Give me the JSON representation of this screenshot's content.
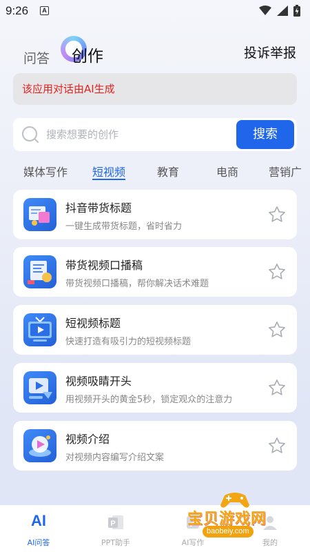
{
  "status": {
    "time": "9:26",
    "notif_letter": "A"
  },
  "header": {
    "tab_qa": "问答",
    "tab_create": "创作",
    "report": "投诉举报"
  },
  "notice": {
    "text": "该应用对话由AI生成"
  },
  "search": {
    "placeholder": "搜索想要的创作",
    "button": "搜索"
  },
  "categories": [
    "媒体写作",
    "短视频",
    "教育",
    "电商",
    "营销广"
  ],
  "active_category": "短视频",
  "cards": [
    {
      "title": "抖音带货标题",
      "desc": "一键生成带货标题，省时省力",
      "icon": "shopping-title-icon"
    },
    {
      "title": "带货视频口播稿",
      "desc": "带货视频口播稿，帮你解决话术难题",
      "icon": "script-board-icon"
    },
    {
      "title": "短视频标题",
      "desc": "快速打造有吸引力的短视频标题",
      "icon": "tv-play-icon"
    },
    {
      "title": "视频吸睛开头",
      "desc": "用视频开头的黄金5秒，锁定观众的注意力",
      "icon": "video-play-icon"
    },
    {
      "title": "视频介绍",
      "desc": "对视频内容编写介绍文案",
      "icon": "video-intro-icon"
    }
  ],
  "bottom_nav": [
    {
      "label": "AI问答",
      "icon_text": "AI",
      "active": true
    },
    {
      "label": "PPT助手",
      "icon_text": "P",
      "active": false
    },
    {
      "label": "AI写作",
      "icon_text": "",
      "active": false
    },
    {
      "label": "我的",
      "icon_text": "",
      "active": false
    }
  ],
  "watermark": {
    "text": "宝贝游戏网",
    "url": "baobeiy.com"
  },
  "colors": {
    "accent": "#1f66ea",
    "notice_text": "#e0241f",
    "watermark": "#f3a614"
  }
}
